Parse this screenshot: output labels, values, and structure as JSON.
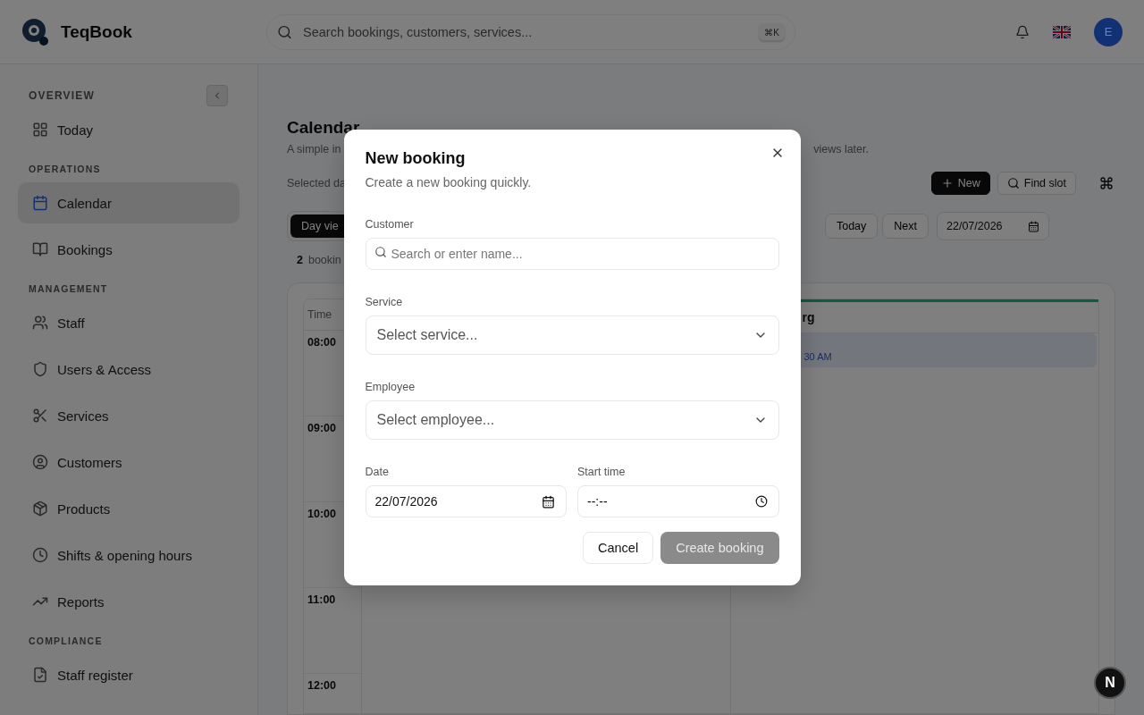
{
  "app": {
    "name": "TeqBook"
  },
  "topbar": {
    "search": {
      "placeholder": "Search bookings, customers, services...",
      "shortcut": "⌘K"
    },
    "avatar": "E"
  },
  "sidebar": {
    "sections": [
      {
        "title": "OVERVIEW",
        "items": [
          {
            "label": "Today",
            "selected": false
          }
        ]
      },
      {
        "title": "OPERATIONS",
        "items": [
          {
            "label": "Calendar",
            "selected": true
          },
          {
            "label": "Bookings",
            "selected": false
          }
        ]
      },
      {
        "title": "MANAGEMENT",
        "items": [
          {
            "label": "Staff",
            "selected": false
          },
          {
            "label": "Users & Access",
            "selected": false
          },
          {
            "label": "Services",
            "selected": false
          },
          {
            "label": "Customers",
            "selected": false
          },
          {
            "label": "Products",
            "selected": false
          },
          {
            "label": "Shifts & opening hours",
            "selected": false
          },
          {
            "label": "Reports",
            "selected": false
          }
        ]
      },
      {
        "title": "COMPLIANCE",
        "items": [
          {
            "label": "Staff register",
            "selected": false
          }
        ]
      }
    ]
  },
  "page": {
    "title": "Calendar",
    "subtitle_start": "A simple in",
    "subtitle_end": "views later.",
    "selected_date_label": "Selected da",
    "actions": [
      {
        "label": "New",
        "primary": true
      },
      {
        "label": "Find slot",
        "primary": false
      }
    ],
    "view_tab": {
      "label": "Day vie",
      "selected": true
    },
    "nav_buttons": [
      "Today",
      "Next"
    ],
    "date": "22/07/2026",
    "count": "2",
    "count_label": "bookin"
  },
  "calendar": {
    "time_header": "Time",
    "hours": [
      "08:00",
      "09:00",
      "10:00",
      "11:00",
      "12:00"
    ],
    "column_header": "rg",
    "event_time": "30 AM"
  },
  "dialog": {
    "title": "New booking",
    "subtitle": "Create a new booking quickly.",
    "customer": {
      "label": "Customer",
      "placeholder": "Search or enter name..."
    },
    "service": {
      "label": "Service",
      "placeholder": "Select service..."
    },
    "employee": {
      "label": "Employee",
      "placeholder": "Select employee..."
    },
    "date": {
      "label": "Date",
      "value": "22/07/2026"
    },
    "start_time": {
      "label": "Start time",
      "value": "--:--"
    },
    "buttons": [
      {
        "label": "Cancel",
        "primary": false,
        "disabled": false
      },
      {
        "label": "Create booking",
        "primary": true,
        "disabled": true
      }
    ]
  },
  "dev_badge": "N"
}
